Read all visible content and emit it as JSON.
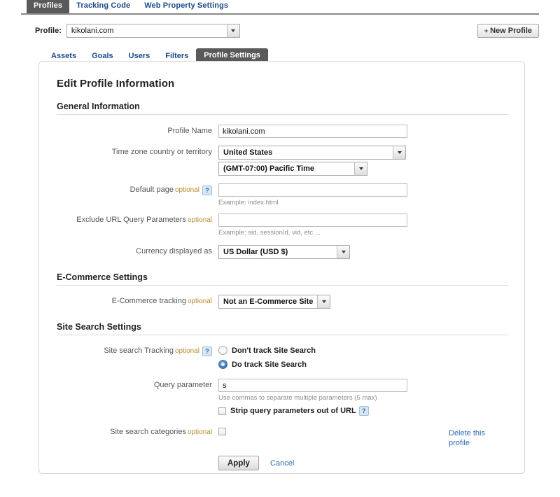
{
  "top_tabs": [
    {
      "label": "Profiles",
      "active": true
    },
    {
      "label": "Tracking Code",
      "active": false
    },
    {
      "label": "Web Property Settings",
      "active": false
    }
  ],
  "profile_selector": {
    "label": "Profile:",
    "value": "kikolani.com"
  },
  "new_profile_button": {
    "plus": "+",
    "label": "New Profile"
  },
  "sub_tabs": [
    {
      "label": "Assets",
      "active": false
    },
    {
      "label": "Goals",
      "active": false
    },
    {
      "label": "Users",
      "active": false
    },
    {
      "label": "Filters",
      "active": false
    },
    {
      "label": "Profile Settings",
      "active": true
    }
  ],
  "page_title": "Edit Profile Information",
  "sections": {
    "general": {
      "title": "General Information",
      "profile_name": {
        "label": "Profile Name",
        "value": "kikolani.com"
      },
      "timezone": {
        "label": "Time zone country or territory",
        "country": "United States",
        "zone": "(GMT-07:00) Pacific Time"
      },
      "default_page": {
        "label": "Default page",
        "optional": "optional",
        "help": "?",
        "value": "",
        "hint": "Example: index.html"
      },
      "exclude_url": {
        "label": "Exclude URL Query Parameters",
        "optional": "optional",
        "value": "",
        "hint": "Example: sid, sessionId, vid, etc ..."
      },
      "currency": {
        "label": "Currency displayed as",
        "value": "US Dollar (USD $)"
      }
    },
    "ecommerce": {
      "title": "E-Commerce Settings",
      "tracking": {
        "label": "E-Commerce tracking",
        "optional": "optional",
        "value": "Not an E-Commerce Site"
      }
    },
    "site_search": {
      "title": "Site Search Settings",
      "tracking": {
        "label": "Site search Tracking",
        "optional": "optional",
        "help": "?",
        "options": [
          {
            "label": "Don't track Site Search",
            "checked": false
          },
          {
            "label": "Do track Site Search",
            "checked": true
          }
        ]
      },
      "query_parameter": {
        "label": "Query parameter",
        "value": "s",
        "hint": "Use commas to separate multiple parameters (5 max)"
      },
      "strip_query": {
        "label": "Strip query parameters out of URL",
        "help": "?",
        "checked": false
      },
      "categories": {
        "label": "Site search categories",
        "optional": "optional",
        "checked": false
      }
    }
  },
  "footer": {
    "apply_label": "Apply",
    "cancel_label": "Cancel",
    "delete_line1": "Delete this",
    "delete_line2": "profile"
  },
  "colors": {
    "link": "#2b6bb5",
    "active_tab_bg": "#5a5a5a",
    "optional_text": "#b98a2e"
  }
}
